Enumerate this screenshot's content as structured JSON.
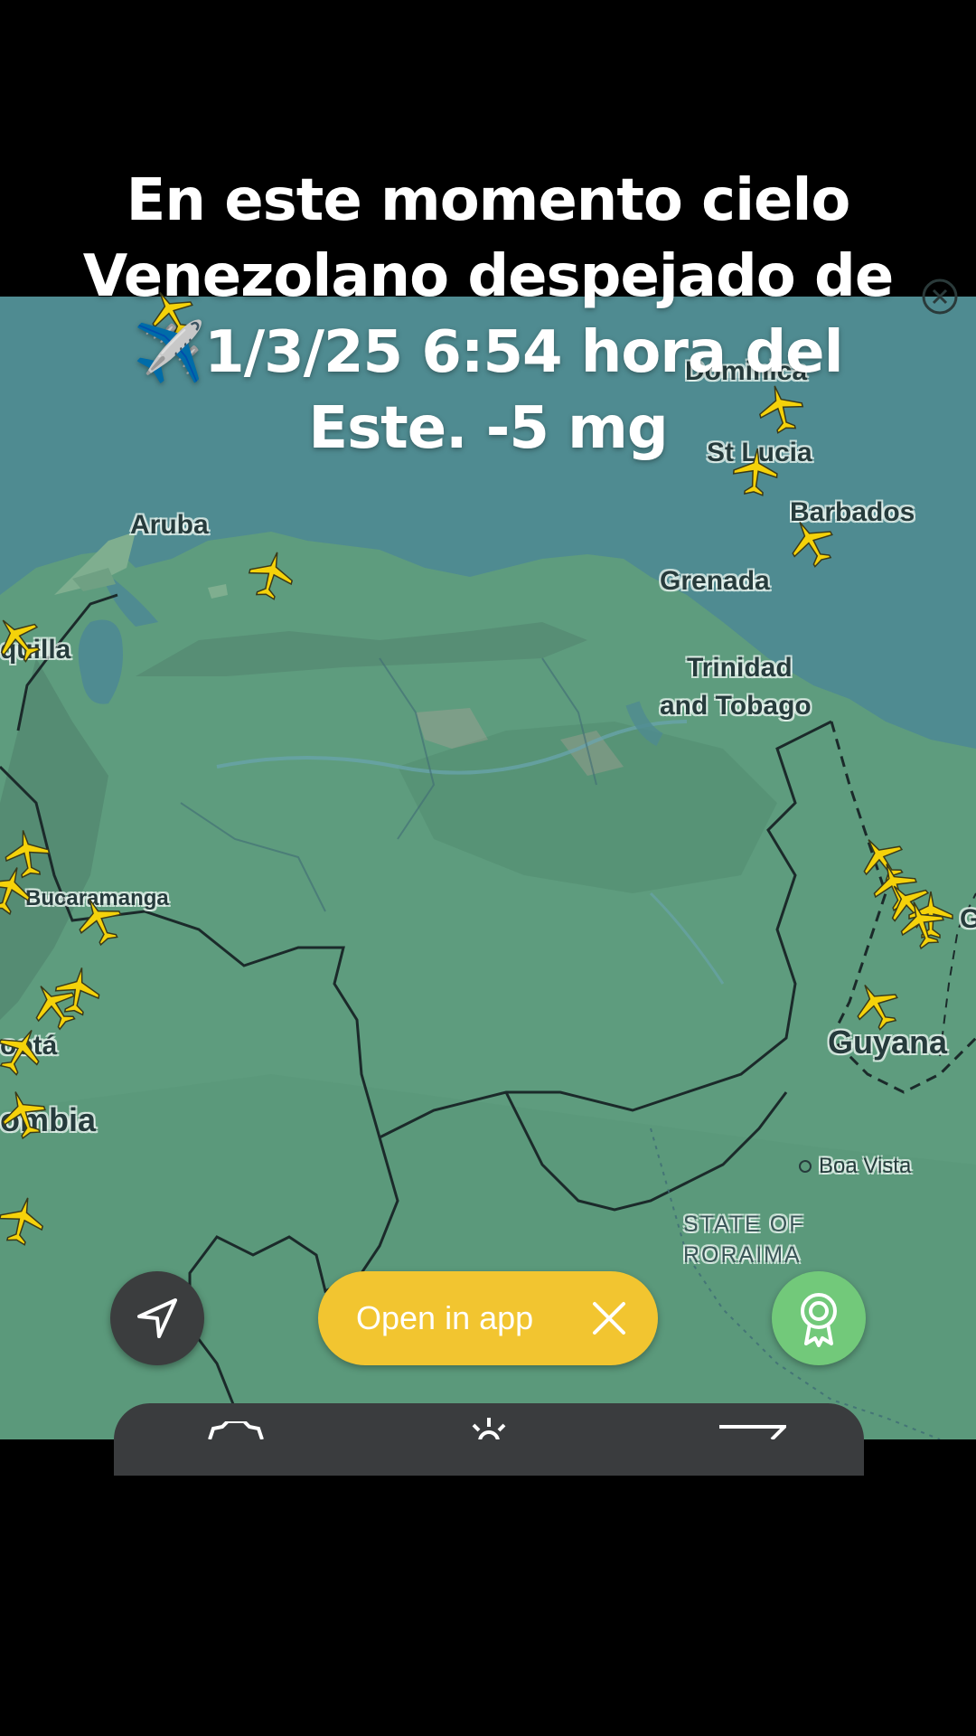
{
  "caption": {
    "line1": "En este momento cielo",
    "line2": "Venezolano despejado de",
    "line3": "✈️1/3/25 6:54 hora del",
    "line4": "Este. -5 mg"
  },
  "map": {
    "labels": {
      "aruba": "Aruba",
      "st_lucia": "St Lucia",
      "barbados": "Barbados",
      "grenada": "Grenada",
      "trinidad_1": "Trinidad",
      "trinidad_2": "and Tobago",
      "barranquilla": "quilla",
      "bucaramanga": "Bucaramanga",
      "bogota": "ootá",
      "colombia": "ombia",
      "guyana": "Guyana",
      "boa_vista": "Boa Vista",
      "state_1": "STATE OF",
      "state_2": "RORAIMA",
      "dominica": "Dominica",
      "edge_g": "G"
    },
    "colors": {
      "sea": "#4f8b91",
      "land": "#5c9c7c",
      "plane": "#f5d20a"
    }
  },
  "controls": {
    "navigate_icon": "navigation-arrow-icon",
    "open_in_app_label": "Open in app",
    "open_close_icon": "close-icon",
    "award_icon": "award-ribbon-icon",
    "accent": "#f2c530"
  }
}
